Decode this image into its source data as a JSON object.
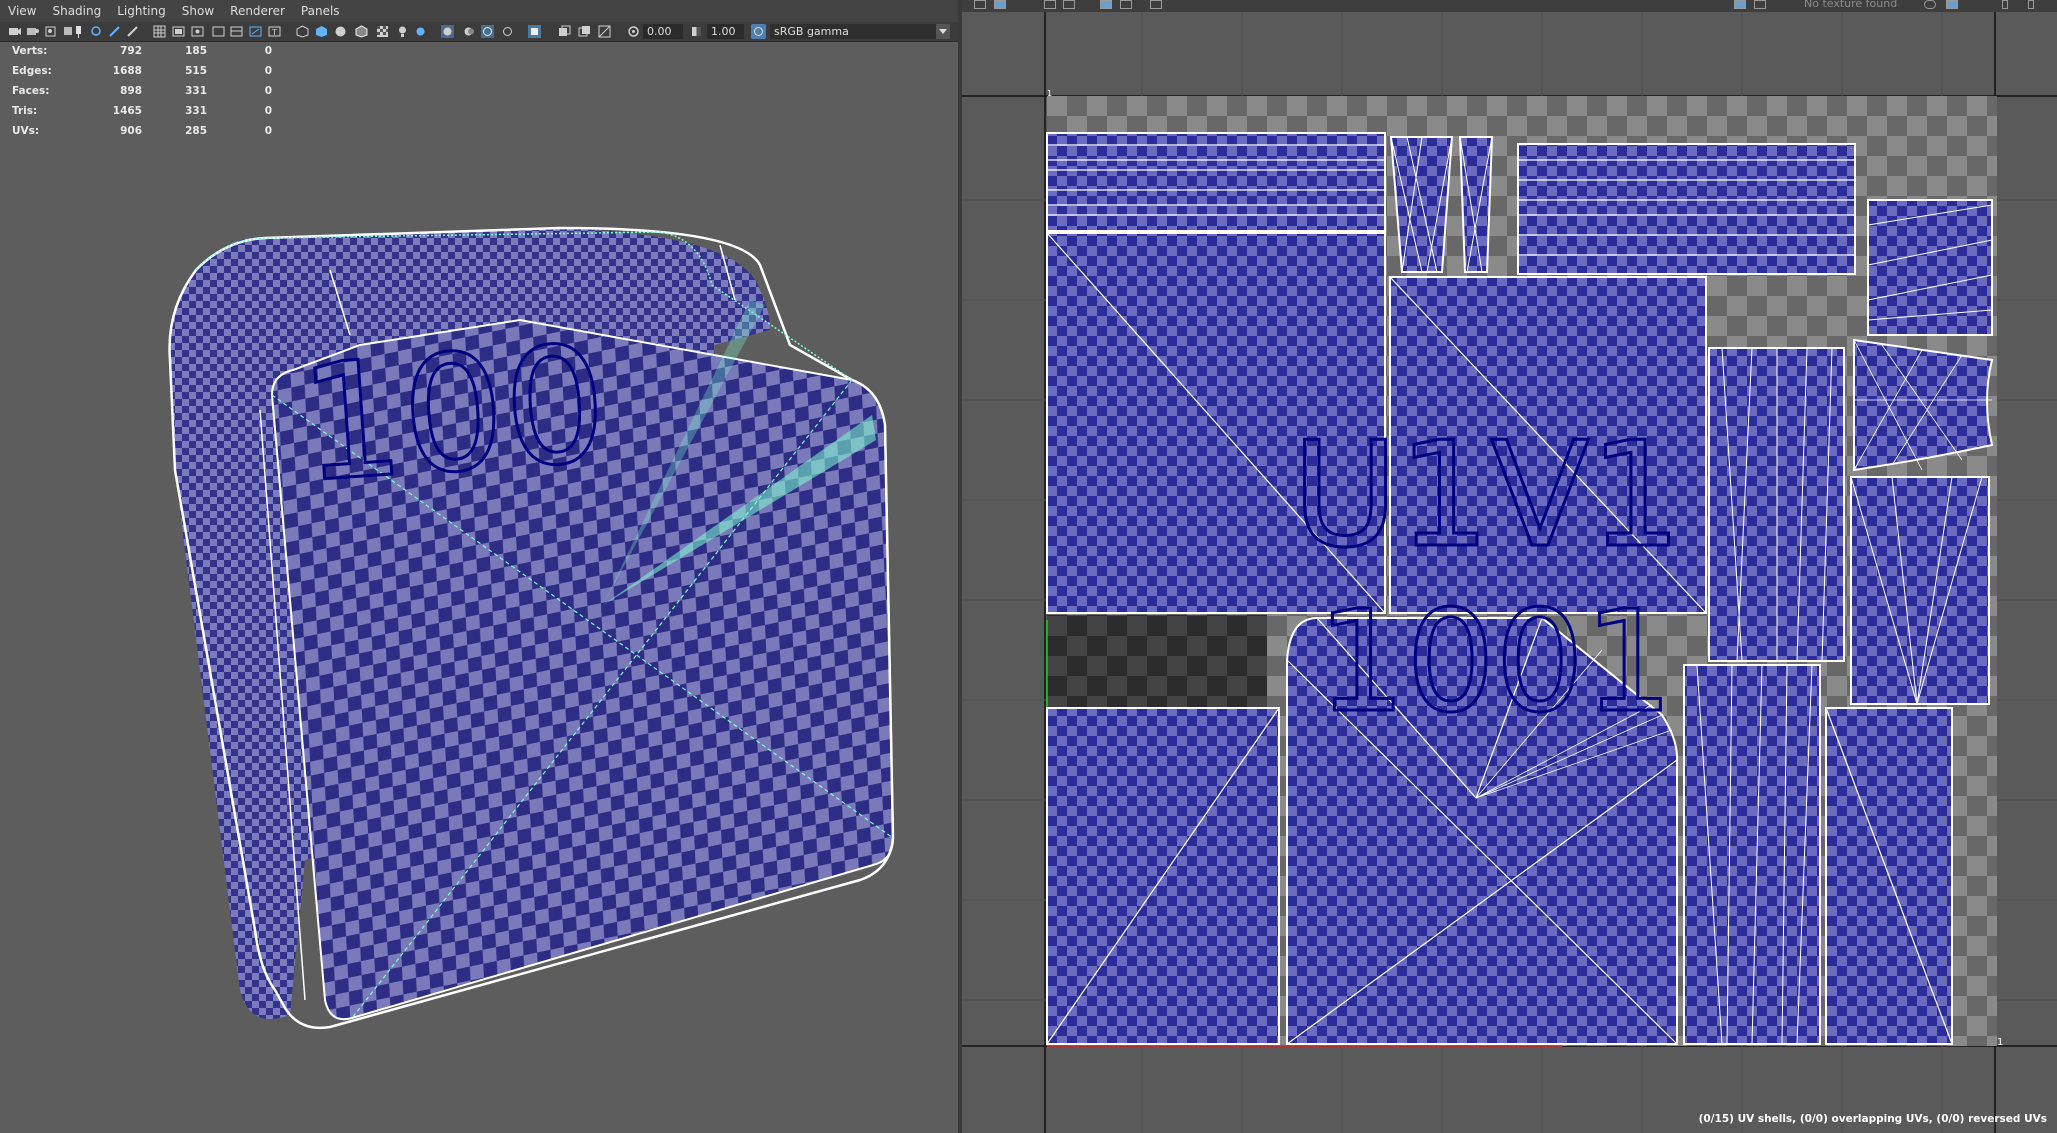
{
  "menu": [
    "View",
    "Shading",
    "Lighting",
    "Show",
    "Renderer",
    "Panels"
  ],
  "toolbar": {
    "exposure_value": "0.00",
    "gamma_value": "1.00",
    "color_space": "sRGB gamma"
  },
  "hud": {
    "rows": [
      {
        "label": "Verts:",
        "values": [
          "792",
          "185",
          "0"
        ]
      },
      {
        "label": "Edges:",
        "values": [
          "1688",
          "515",
          "0"
        ]
      },
      {
        "label": "Faces:",
        "values": [
          "898",
          "331",
          "0"
        ]
      },
      {
        "label": "Tris:",
        "values": [
          "1465",
          "331",
          "0"
        ]
      },
      {
        "label": "UVs:",
        "values": [
          "906",
          "285",
          "0"
        ]
      }
    ]
  },
  "viewport": {
    "face_label": "100"
  },
  "uv_editor": {
    "header_text": "No texture found",
    "tile_labels": [
      "U1V1",
      "1001"
    ],
    "status": "(0/15) UV shells, (0/0) overlapping UVs, (0/0) reversed UVs",
    "axis_mark": "1"
  },
  "colors": {
    "viewport_bg": "#5d5d5d",
    "uv_fill": "#3c3ca8",
    "wire_selected": "#7fffd4",
    "wire": "#ffffff",
    "text_label": "#000080"
  }
}
